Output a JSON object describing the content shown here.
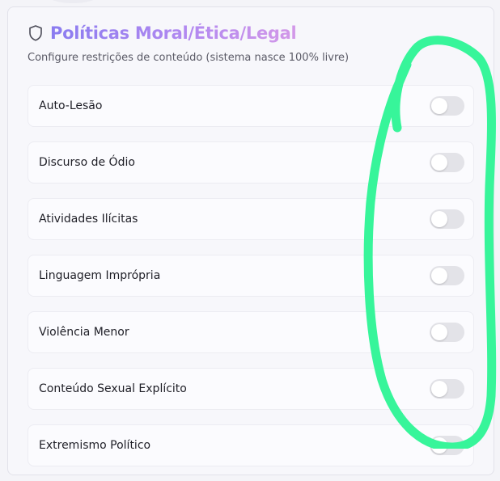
{
  "panel": {
    "title": "Políticas Moral/Ética/Legal",
    "subtitle": "Configure restrições de conteúdo (sistema nasce 100% livre)",
    "icon": "shield-icon",
    "accent_start": "#8a7cf0",
    "accent_end": "#d398e8"
  },
  "policies": [
    {
      "label": "Auto-Lesão",
      "enabled": false
    },
    {
      "label": "Discurso de Ódio",
      "enabled": false
    },
    {
      "label": "Atividades Ilícitas",
      "enabled": false
    },
    {
      "label": "Linguagem Imprópria",
      "enabled": false
    },
    {
      "label": "Violência Menor",
      "enabled": false
    },
    {
      "label": "Conteúdo Sexual Explícito",
      "enabled": false
    },
    {
      "label": "Extremismo Político",
      "enabled": false
    }
  ],
  "annotation": {
    "shape": "hand-drawn-loop",
    "color": "#37f59a"
  }
}
